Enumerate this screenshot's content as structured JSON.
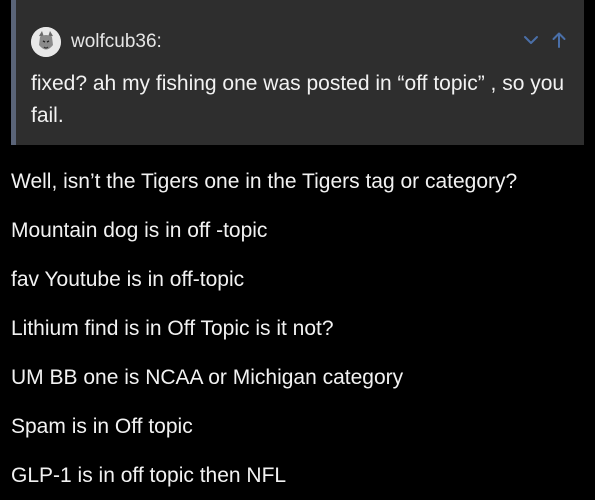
{
  "quote": {
    "username": "wolfcub36:",
    "text": "fixed? ah my fishing one was posted in “off topic” , so you fail.",
    "expand_icon": "chevron-down-icon",
    "jump_icon": "arrow-up-icon"
  },
  "post": {
    "paragraphs": [
      "Well, isn’t the Tigers one in the Tigers tag or category?",
      "Mountain dog is in off -topic",
      "fav Youtube is in off-topic",
      "Lithium find is in Off Topic is it not?",
      "UM BB one is NCAA or Michigan category",
      "Spam is in Off topic",
      "GLP-1 is in off topic then NFL"
    ]
  },
  "colors": {
    "background": "#000000",
    "quote_background": "#2e2e2e",
    "quote_border": "#5a6478",
    "control_icons": "#4a6fa8",
    "text": "#f2f2f2"
  }
}
